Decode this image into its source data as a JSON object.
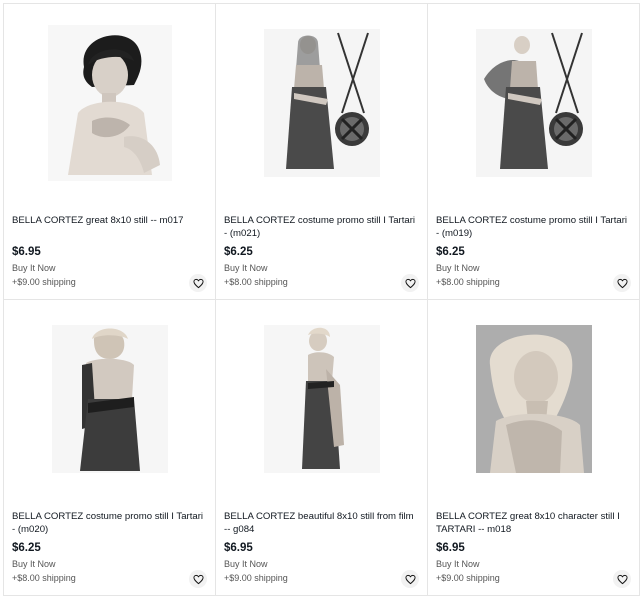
{
  "listings": [
    {
      "title": "BELLA CORTEZ great 8x10 still -- m017",
      "price": "$6.95",
      "format": "Buy It Now",
      "shipping": "+$9.00 shipping",
      "image": "portrait-seated-photo"
    },
    {
      "title": "BELLA CORTEZ costume promo still I Tartari - (m021)",
      "price": "$6.25",
      "format": "Buy It Now",
      "shipping": "+$8.00 shipping",
      "image": "costume-with-shield-photo"
    },
    {
      "title": "BELLA CORTEZ costume promo still I Tartari - (m019)",
      "price": "$6.25",
      "format": "Buy It Now",
      "shipping": "+$8.00 shipping",
      "image": "costume-cape-shield-photo"
    },
    {
      "title": "BELLA CORTEZ costume promo still I Tartari - (m020)",
      "price": "$6.25",
      "format": "Buy It Now",
      "shipping": "+$8.00 shipping",
      "image": "costume-standing-photo"
    },
    {
      "title": "BELLA CORTEZ beautiful 8x10 still from film -- g084",
      "price": "$6.95",
      "format": "Buy It Now",
      "shipping": "+$9.00 shipping",
      "image": "gown-standing-photo"
    },
    {
      "title": "BELLA CORTEZ great 8x10 character still I TARTARI -- m018",
      "price": "$6.95",
      "format": "Buy It Now",
      "shipping": "+$9.00 shipping",
      "image": "portrait-closeup-photo"
    }
  ],
  "icons": {
    "watch": "heart-icon"
  }
}
